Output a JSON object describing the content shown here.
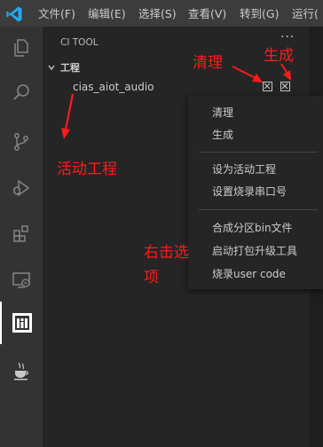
{
  "titlebar": {
    "menus": [
      "文件(F)",
      "编辑(E)",
      "选择(S)",
      "查看(V)",
      "转到(G)",
      "运行("
    ]
  },
  "activitybar": {
    "items": [
      {
        "name": "explorer-icon"
      },
      {
        "name": "search-icon"
      },
      {
        "name": "source-control-icon"
      },
      {
        "name": "run-debug-icon"
      },
      {
        "name": "extensions-icon"
      },
      {
        "name": "remote-explorer-icon"
      },
      {
        "name": "ci-tool-icon"
      },
      {
        "name": "java-icon"
      }
    ]
  },
  "sidebar": {
    "title": "CI TOOL",
    "more": "···",
    "section_label": "工程",
    "project_name": "cias_aiot_audio"
  },
  "context_menu": {
    "items": [
      "清理",
      "生成",
      "设为活动工程",
      "设置烧录串口号",
      "合成分区bin文件",
      "启动打包升级工具",
      "烧录user code"
    ]
  },
  "annotations": {
    "clean": "清理",
    "build": "生成",
    "active_project": "活动工程",
    "right_click_1": "右击选",
    "right_click_2": "项"
  },
  "colors": {
    "annotation": "#ff1a1a",
    "titlebar": "#3c3c3c",
    "activitybar": "#333333",
    "sidebar": "#252526",
    "vscode_blue": "#23a9f2"
  }
}
